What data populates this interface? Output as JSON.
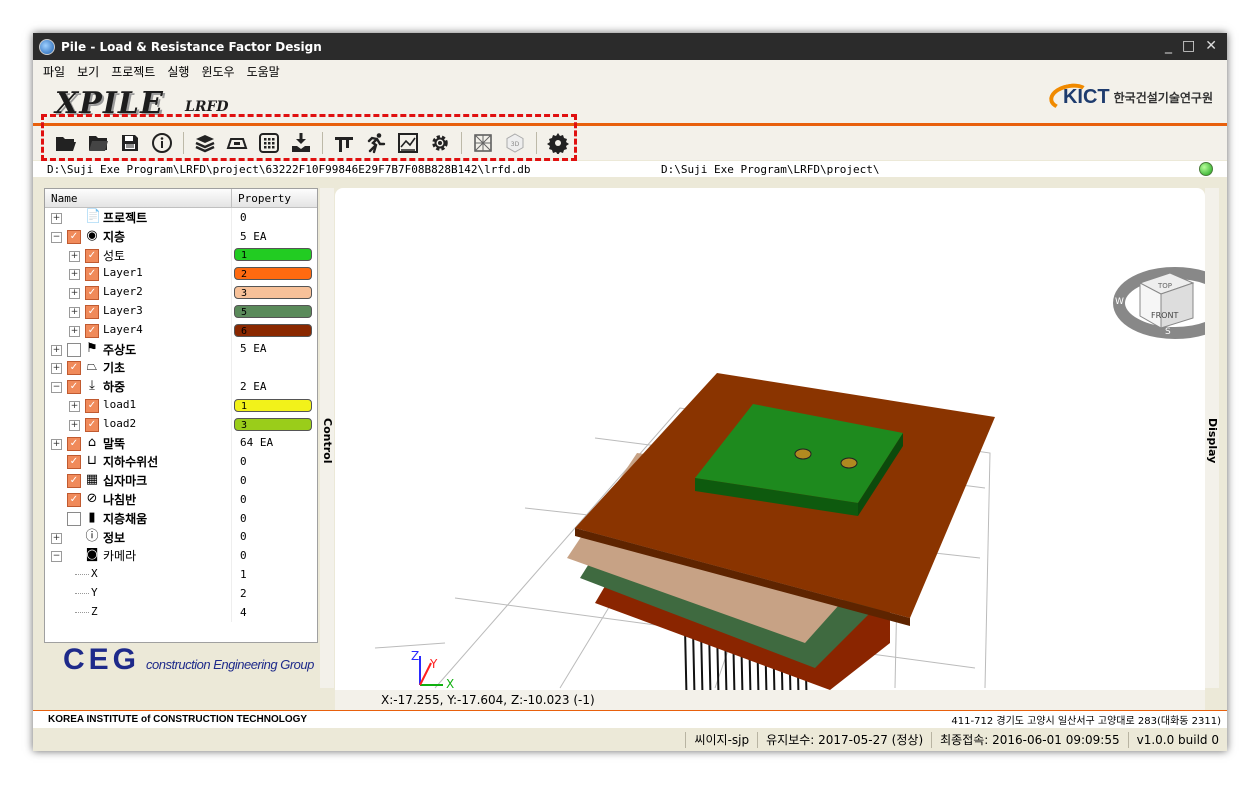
{
  "window": {
    "title": "Pile - Load & Resistance Factor Design",
    "minimize": "_",
    "maximize": "□",
    "close": "✕"
  },
  "menu": [
    "파일",
    "보기",
    "프로젝트",
    "실행",
    "윈도우",
    "도움말"
  ],
  "banner": {
    "logo": "XPILE",
    "logo_sub": "LRFD",
    "org_short": "KICT",
    "org_name": "한국건설기술연구원"
  },
  "toolbar": {
    "icons": [
      "open-folder-icon",
      "open-folder-dark-icon",
      "save-icon",
      "info-icon",
      "layers-icon",
      "foundation-icon",
      "grid-icon",
      "load-icon",
      "pile-icon",
      "run-icon",
      "chart-icon",
      "settings-gear-icon",
      "mesh-icon",
      "3d-icon",
      "gear-icon"
    ]
  },
  "paths": {
    "db": "D:\\Suji Exe Program\\LRFD\\project\\63222F10F99846E29F7B7F08B828B142\\lrfd.db",
    "project": "D:\\Suji Exe Program\\LRFD\\project\\"
  },
  "tree": {
    "header_name": "Name",
    "header_property": "Property",
    "rows": [
      {
        "label": "프로젝트",
        "value": "0"
      },
      {
        "label": "지층",
        "value": "5 EA"
      },
      {
        "label": "성토",
        "value": "1",
        "color": "#22cc22"
      },
      {
        "label": "Layer1",
        "value": "2",
        "color": "#ff6a10"
      },
      {
        "label": "Layer2",
        "value": "3",
        "color": "#f7c199"
      },
      {
        "label": "Layer3",
        "value": "5",
        "color": "#5a8a5a"
      },
      {
        "label": "Layer4",
        "value": "6",
        "color": "#8a2800"
      },
      {
        "label": "주상도",
        "value": "5 EA"
      },
      {
        "label": "기초",
        "value": ""
      },
      {
        "label": "하중",
        "value": "2 EA"
      },
      {
        "label": "load1",
        "value": "1",
        "color": "#f2f21a"
      },
      {
        "label": "load2",
        "value": "3",
        "color": "#9acd1a"
      },
      {
        "label": "말뚝",
        "value": "64 EA"
      },
      {
        "label": "지하수위선",
        "value": "0"
      },
      {
        "label": "십자마크",
        "value": "0"
      },
      {
        "label": "나침반",
        "value": "0"
      },
      {
        "label": "지층채움",
        "value": "0"
      },
      {
        "label": "정보",
        "value": "0"
      },
      {
        "label": "카메라",
        "value": "0"
      },
      {
        "label": "X",
        "value": "1"
      },
      {
        "label": "Y",
        "value": "2"
      },
      {
        "label": "Z",
        "value": "4"
      }
    ]
  },
  "ceg": {
    "logo": "CEG",
    "sub": "construction Engineering Group"
  },
  "tabs": {
    "control": "Control",
    "display": "Display"
  },
  "viewcube": {
    "top": "TOP",
    "front": "FRONT",
    "w": "W",
    "s": "S",
    "e": "E"
  },
  "axes": {
    "x": "X",
    "y": "Y",
    "z": "Z"
  },
  "coords": "X:-17.255, Y:-17.604, Z:-10.023 (-1)",
  "footer": {
    "institute": "KOREA INSTITUTE of CONSTRUCTION TECHNOLOGY",
    "address": "411-712 경기도 고양시 일산서구 고양대로 283(대화동 2311)"
  },
  "status": [
    "씨이지-sjp",
    "유지보수: 2017-05-27 (정상)",
    "최종접속: 2016-06-01 09:09:55",
    "v1.0.0 build 0"
  ],
  "colors": {
    "accent": "#e8600c",
    "layer_top": "#8a3400",
    "foundation": "#1e8a1e"
  }
}
